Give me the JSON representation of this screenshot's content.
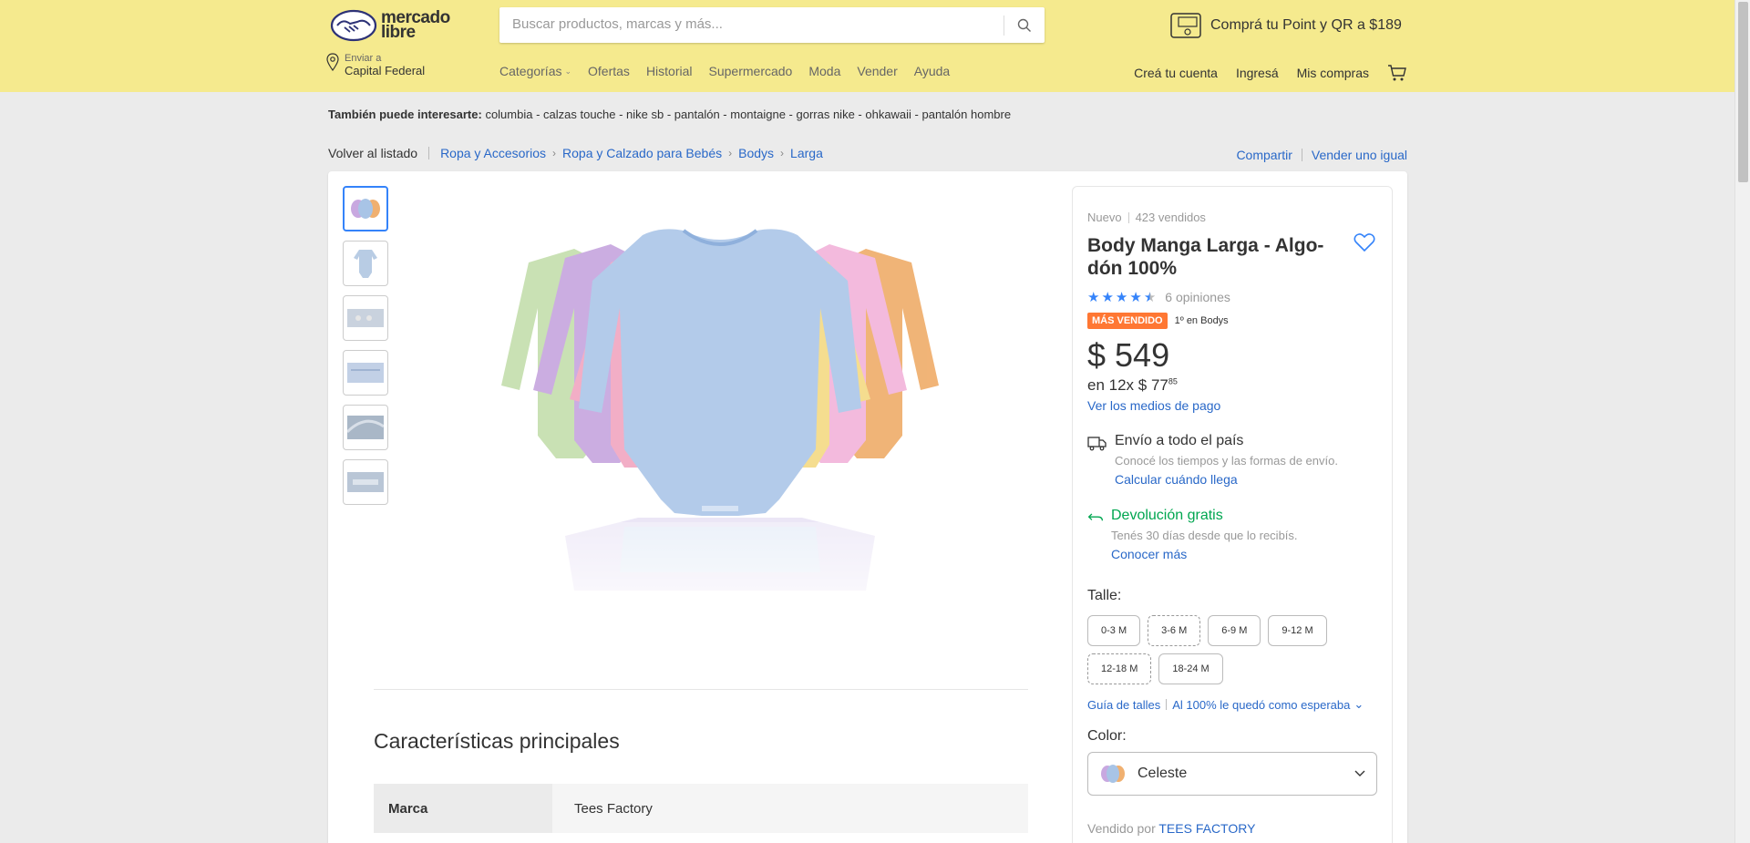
{
  "header": {
    "logo_text_1": "mercado",
    "logo_text_2": "libre",
    "search_placeholder": "Buscar productos, marcas y más...",
    "promo": "Comprá tu Point y QR a $189",
    "location_label": "Enviar a",
    "location_value": "Capital Federal",
    "nav": [
      "Categorías",
      "Ofertas",
      "Historial",
      "Supermercado",
      "Moda",
      "Vender",
      "Ayuda"
    ],
    "user_nav": [
      "Creá tu cuenta",
      "Ingresá",
      "Mis compras"
    ]
  },
  "related": {
    "label": "También puede interesarte:",
    "items": "columbia - calzas touche - nike sb - pantalón - montaigne - gorras nike - ohkawaii - pantalón hombre"
  },
  "breadcrumb": {
    "back": "Volver al listado",
    "items": [
      "Ropa y Accesorios",
      "Ropa y Calzado para Bebés",
      "Bodys",
      "Larga"
    ],
    "share": "Compartir",
    "sell_same": "Vender uno igual"
  },
  "product": {
    "condition": "Nuevo",
    "sold": "423 vendidos",
    "title": "Body Manga Larga - Algo-dón 100%",
    "rating": 4.5,
    "rating_count": "6 opiniones",
    "badge": "MÁS VENDIDO",
    "badge_rank": "1º en Bodys",
    "price": "$ 549",
    "installments": "en 12x $ 77",
    "installments_cents": "85",
    "payment_link": "Ver los medios de pago",
    "shipping_title": "Envío a todo el país",
    "shipping_sub": "Conocé los tiempos y las formas de envío.",
    "shipping_link": "Calcular cuándo llega",
    "return_title": "Devolución gratis",
    "return_sub": "Tenés 30 días desde que lo recibís.",
    "return_link": "Conocer más",
    "size_label": "Talle:",
    "sizes": [
      {
        "label": "0-3 M",
        "dashed": false
      },
      {
        "label": "3-6 M",
        "dashed": true
      },
      {
        "label": "6-9 M",
        "dashed": false
      },
      {
        "label": "9-12 M",
        "dashed": false
      },
      {
        "label": "12-18 M",
        "dashed": true
      },
      {
        "label": "18-24 M",
        "dashed": false
      }
    ],
    "size_guide": "Guía de talles",
    "size_fit": "Al 100% le quedó como esperaba",
    "color_label": "Color:",
    "color_value": "Celeste",
    "seller_label": "Vendido por",
    "seller_name": "TEES FACTORY"
  },
  "specs": {
    "title": "Características principales",
    "rows": [
      {
        "key": "Marca",
        "value": "Tees Factory"
      }
    ]
  },
  "colors": {
    "header_bg": "#fff159",
    "link": "#3483fa",
    "green": "#00a650",
    "badge": "#ff7733"
  }
}
